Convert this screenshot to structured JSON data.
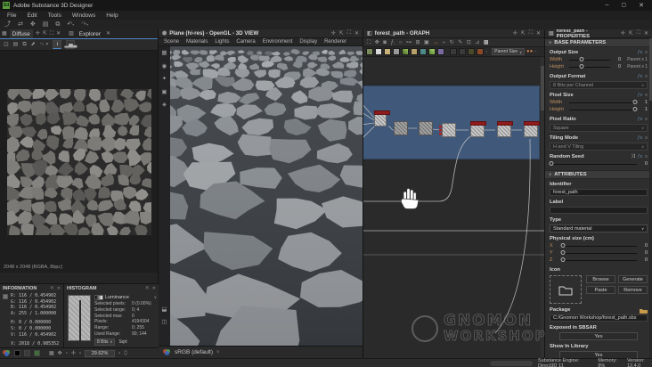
{
  "window": {
    "title": "Adobe Substance 3D Designer",
    "logo": "Sd",
    "controls": {
      "minimize": "–",
      "maximize": "▢",
      "close": "✕"
    }
  },
  "menubar": {
    "items": [
      "File",
      "Edit",
      "Tools",
      "Windows",
      "Help"
    ]
  },
  "panel2d": {
    "tab_diffuse": "Diffuse",
    "tab_explorer": "Explorer",
    "texture_info": "2048 x 2048 (RGBA, 8bpc)",
    "zoom": "29.62%"
  },
  "information": {
    "title": "INFORMATION",
    "rows": [
      [
        "R:",
        "116 / 0.454902"
      ],
      [
        "G:",
        "116 / 0.454902"
      ],
      [
        "B:",
        "116 / 0.454902"
      ],
      [
        "A:",
        "255 / 1.000000"
      ],
      [
        "H:",
        "0 / 0.000000"
      ],
      [
        "S:",
        "0 / 0.000000"
      ],
      [
        "V:",
        "116 / 0.454902"
      ],
      [
        "X:",
        "2018 / 0.985352"
      ]
    ]
  },
  "histogram": {
    "title": "HISTOGRAM",
    "channel": "Luminance",
    "rows": [
      [
        "Selected pixels:",
        "0 (0.00%)"
      ],
      [
        "Selected range:",
        "0; 4"
      ],
      [
        "Selected max:",
        "0"
      ],
      [
        "Pixels:",
        "4194304"
      ],
      [
        "Range:",
        "0; 255"
      ],
      [
        "Used Range:",
        "90; 144"
      ]
    ],
    "bits": "8 Bits",
    "scale": "Sqrt"
  },
  "view3d": {
    "title": "Plane (hi-res) - OpenGL - 3D VIEW",
    "menus": [
      "Scene",
      "Materials",
      "Lights",
      "Camera",
      "Environment",
      "Display",
      "Renderer"
    ],
    "colorspace": "sRGB (default)"
  },
  "graph": {
    "title": "forest_path - GRAPH",
    "size_label": "Parent Size"
  },
  "properties": {
    "title": "forest_path - PROPERTIES",
    "section_base": "BASE PARAMETERS",
    "section_attributes": "ATTRIBUTES",
    "output_size": {
      "label": "Output Size",
      "width_label": "Width",
      "height_label": "Height",
      "width_value": "0",
      "height_value": "0",
      "width_unit": "Parent x 1",
      "height_unit": "Parent x 1"
    },
    "output_format": {
      "label": "Output Format",
      "value": "8 Bits per Channel"
    },
    "pixel_size": {
      "label": "Pixel Size",
      "width_label": "Width",
      "height_label": "Height",
      "width_value": "1",
      "height_value": "1"
    },
    "pixel_ratio": {
      "label": "Pixel Ratio",
      "value": "Square"
    },
    "tiling_mode": {
      "label": "Tiling Mode",
      "value": "H and V Tiling"
    },
    "random_seed": {
      "label": "Random Seed",
      "value": "0"
    },
    "identifier": {
      "label": "Identifier",
      "value": "forest_path"
    },
    "label_field": {
      "label": "Label",
      "value": ""
    },
    "type": {
      "label": "Type",
      "value": "Standard material"
    },
    "physical_size": {
      "label": "Physical size (cm)",
      "x_label": "X",
      "y_label": "Y",
      "z_label": "Z",
      "x_value": "0",
      "y_value": "0",
      "z_value": "0"
    },
    "icon": {
      "label": "Icon",
      "buttons": [
        "Browse",
        "Generate",
        "Paste",
        "Remove"
      ]
    },
    "package": {
      "label": "Package",
      "value": "C:/Gnomon Workshop/forest_path.sbs"
    },
    "exposed": {
      "label": "Exposed in SBSAR",
      "value": "Yes"
    },
    "library": {
      "label": "Show In Library",
      "value": "Yes"
    }
  },
  "statusbar": {
    "engine": "Substance Engine: Direct3D 11",
    "memory": "Memory: 8%",
    "version": "Version: 12.4.0"
  },
  "watermark": {
    "line1": "GNOMON",
    "line2": "WORKSHOP"
  }
}
